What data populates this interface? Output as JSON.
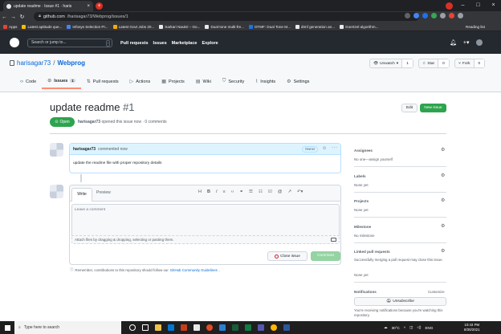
{
  "browser": {
    "tab_title": "update readme · Issue #1 · haris",
    "url_host": "github.com",
    "url_path": "/harisagar73/Webprog/issues/1",
    "reading_list": "Reading list",
    "bookmarks": [
      {
        "label": "Apps"
      },
      {
        "label": "Latest aptitude que..."
      },
      {
        "label": "Infosys Selection Pr..."
      },
      {
        "label": "Latest Govt Jobs 20..."
      },
      {
        "label": "Sarkari Naukri – Go..."
      },
      {
        "label": "Dual-tone multi-fre..."
      },
      {
        "label": "DTMF: Dual Tone M..."
      },
      {
        "label": "dtmf generation an..."
      },
      {
        "label": "Goertzel algorithm..."
      }
    ]
  },
  "github": {
    "search_placeholder": "Search or jump to...",
    "search_key": "/",
    "nav": [
      "Pull requests",
      "Issues",
      "Marketplace",
      "Explore"
    ]
  },
  "repo": {
    "owner": "harisagar73",
    "name": "Webprog",
    "watch_label": "Unwatch",
    "watch_count": "1",
    "star_label": "Star",
    "star_count": "0",
    "fork_label": "Fork",
    "fork_count": "0",
    "tabs": [
      {
        "label": "Code"
      },
      {
        "label": "Issues",
        "count": "1"
      },
      {
        "label": "Pull requests"
      },
      {
        "label": "Actions"
      },
      {
        "label": "Projects"
      },
      {
        "label": "Wiki"
      },
      {
        "label": "Security"
      },
      {
        "label": "Insights"
      },
      {
        "label": "Settings"
      }
    ]
  },
  "issue": {
    "title": "update readme",
    "number": "#1",
    "state": "Open",
    "author": "harisagar73",
    "meta_rest": "opened this issue now · 0 comments",
    "edit_label": "Edit",
    "new_issue_label": "New issue"
  },
  "comment": {
    "author": "harisagar73",
    "time": "commented now",
    "badge": "Owner",
    "body": "update the readme file with proper repository details"
  },
  "editor": {
    "write_tab": "Write",
    "preview_tab": "Preview",
    "placeholder": "Leave a comment",
    "attach_text": "Attach files by dragging & dropping, selecting or pasting them.",
    "close_issue_label": "Close issue",
    "comment_label": "Comment",
    "tip_prefix": "Remember, contributions to this repository should follow our",
    "tip_link": "GitHub Community Guidelines",
    "tip_suffix": "."
  },
  "sidebar": {
    "assignees_title": "Assignees",
    "assignees_value": "No one—assign yourself",
    "labels_title": "Labels",
    "labels_value": "None yet",
    "projects_title": "Projects",
    "projects_value": "None yet",
    "milestone_title": "Milestone",
    "milestone_value": "No milestone",
    "linked_title": "Linked pull requests",
    "linked_value": "Successfully merging a pull request may close this issue.",
    "linked_value2": "None yet",
    "notifications_title": "Notifications",
    "customize": "Customize",
    "unsubscribe_label": "Unsubscribe",
    "notif_text": "You're receiving notifications because you're watching this repository."
  },
  "taskbar": {
    "search_placeholder": "Type here to search",
    "temperature": "30°C",
    "language": "ENG",
    "time": "10:43 PM",
    "date": "8/30/2021"
  }
}
